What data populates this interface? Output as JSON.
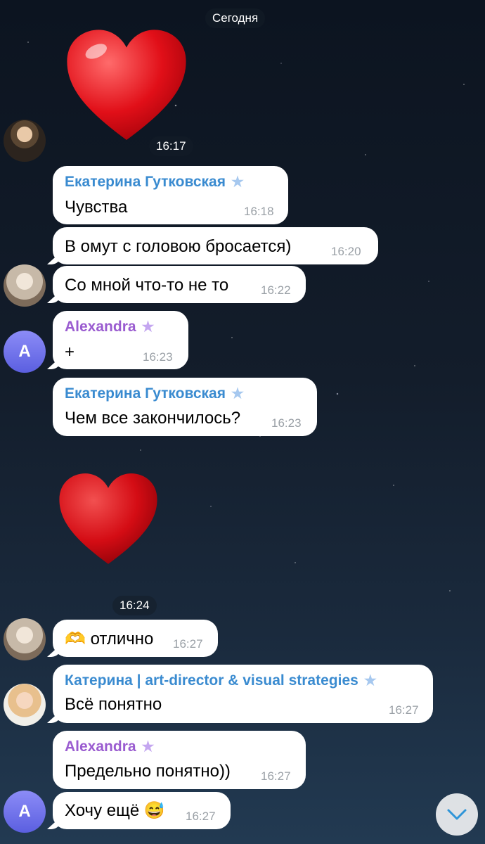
{
  "date_divider": "Сегодня",
  "heart1_time": "16:17",
  "heart2_time": "16:24",
  "colors": {
    "name_blue": "#3a8bd0",
    "name_purple": "#9a5cd0",
    "star_blue": "#a6c8ef",
    "star_purple": "#c4a6f0"
  },
  "messages": [
    {
      "sender": "Екатерина Гутковская",
      "text": "Чувства",
      "time": "16:18"
    },
    {
      "text": "В омут с головою бросается)",
      "time": "16:20"
    },
    {
      "text": "Со мной что-то не то",
      "time": "16:22"
    },
    {
      "sender": "Alexandra",
      "text": "+",
      "time": "16:23"
    },
    {
      "sender": "Екатерина Гутковская",
      "text": "Чем все закончилось?",
      "time": "16:23"
    },
    {
      "text": "отлично",
      "emoji": "🫶",
      "time": "16:27"
    },
    {
      "sender": "Катерина | art-director & visual strategies",
      "text": "Всё понятно",
      "time": "16:27"
    },
    {
      "sender": "Alexandra",
      "text": "Предельно понятно))",
      "time": "16:27"
    },
    {
      "text": "Хочу ещё",
      "emoji": "😅",
      "time": "16:27"
    }
  ],
  "avatar_letters": [
    "A",
    "A"
  ],
  "icons": {
    "star": "star-icon",
    "heart": "heart-sticker",
    "scroll": "chevron-down-icon"
  }
}
